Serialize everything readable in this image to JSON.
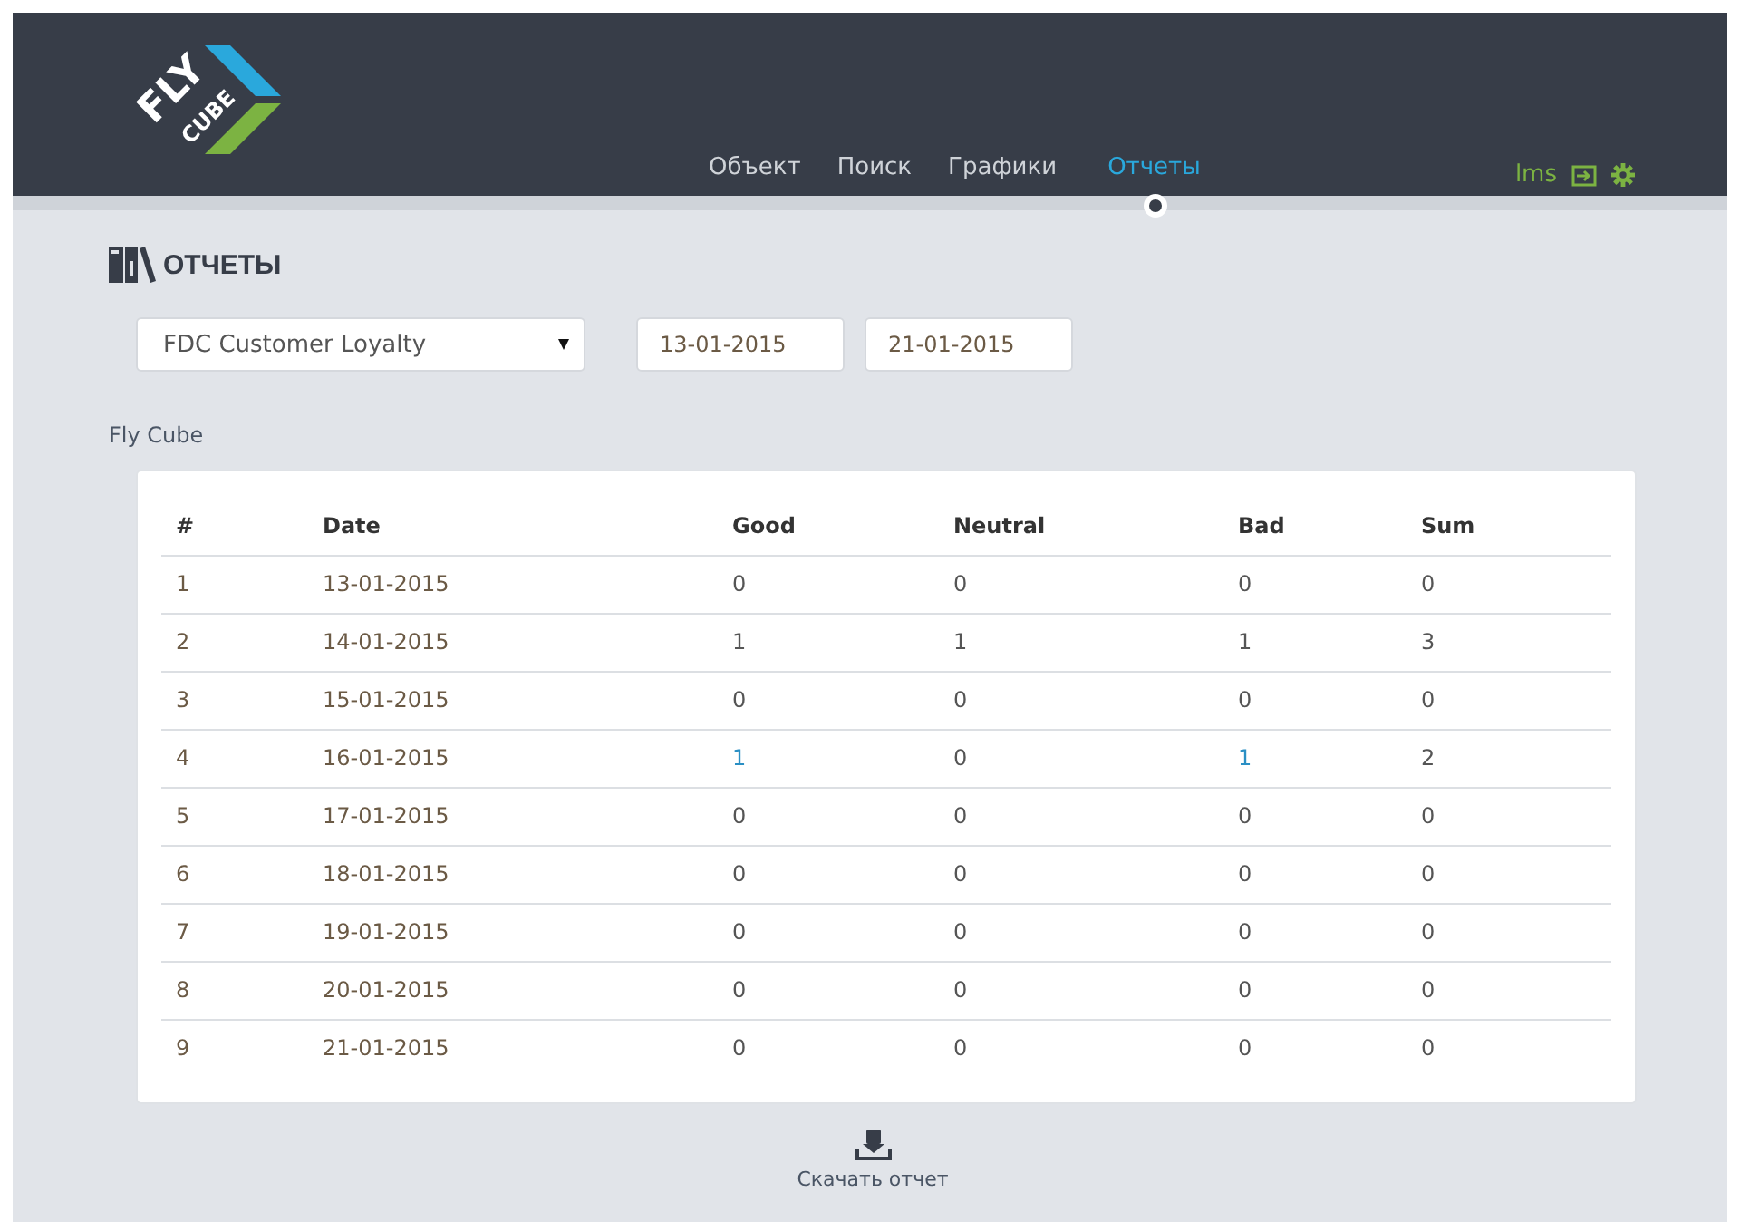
{
  "header": {
    "logo": {
      "line_1": "FLY",
      "line_2": "CUBE"
    },
    "nav": [
      {
        "label": "Объект",
        "selected": false
      },
      {
        "label": "Поиск",
        "selected": false
      },
      {
        "label": "Графики",
        "selected": false
      },
      {
        "label": "Отчеты",
        "selected": true
      }
    ],
    "user": "lms"
  },
  "page_title": "ОТЧЕТЫ",
  "filters": {
    "report": "FDC Customer Loyalty",
    "date_from": "13-01-2015",
    "date_to": "21-01-2015"
  },
  "section_label": "Fly Cube",
  "table": {
    "columns": [
      "#",
      "Date",
      "Good",
      "Neutral",
      "Bad",
      "Sum"
    ],
    "rows": [
      [
        {
          "text": "1",
          "kind": "plain"
        },
        {
          "text": "13-01-2015",
          "kind": "plain"
        },
        {
          "text": "0",
          "kind": "plain"
        },
        {
          "text": "0",
          "kind": "plain"
        },
        {
          "text": "0",
          "kind": "plain"
        },
        {
          "text": "0",
          "kind": "plain"
        }
      ],
      [
        {
          "text": "2",
          "kind": "plain"
        },
        {
          "text": "14-01-2015",
          "kind": "plain"
        },
        {
          "text": "1",
          "kind": "plain"
        },
        {
          "text": "1",
          "kind": "plain"
        },
        {
          "text": "1",
          "kind": "plain"
        },
        {
          "text": "3",
          "kind": "plain"
        }
      ],
      [
        {
          "text": "3",
          "kind": "plain"
        },
        {
          "text": "15-01-2015",
          "kind": "plain"
        },
        {
          "text": "0",
          "kind": "plain"
        },
        {
          "text": "0",
          "kind": "plain"
        },
        {
          "text": "0",
          "kind": "plain"
        },
        {
          "text": "0",
          "kind": "plain"
        }
      ],
      [
        {
          "text": "4",
          "kind": "plain"
        },
        {
          "text": "16-01-2015",
          "kind": "plain"
        },
        {
          "text": "1",
          "kind": "link"
        },
        {
          "text": "0",
          "kind": "plain"
        },
        {
          "text": "1",
          "kind": "link"
        },
        {
          "text": "2",
          "kind": "plain"
        }
      ],
      [
        {
          "text": "5",
          "kind": "plain"
        },
        {
          "text": "17-01-2015",
          "kind": "plain"
        },
        {
          "text": "0",
          "kind": "plain"
        },
        {
          "text": "0",
          "kind": "plain"
        },
        {
          "text": "0",
          "kind": "plain"
        },
        {
          "text": "0",
          "kind": "plain"
        }
      ],
      [
        {
          "text": "6",
          "kind": "plain"
        },
        {
          "text": "18-01-2015",
          "kind": "plain"
        },
        {
          "text": "0",
          "kind": "plain"
        },
        {
          "text": "0",
          "kind": "plain"
        },
        {
          "text": "0",
          "kind": "plain"
        },
        {
          "text": "0",
          "kind": "plain"
        }
      ],
      [
        {
          "text": "7",
          "kind": "plain"
        },
        {
          "text": "19-01-2015",
          "kind": "plain"
        },
        {
          "text": "0",
          "kind": "plain"
        },
        {
          "text": "0",
          "kind": "plain"
        },
        {
          "text": "0",
          "kind": "plain"
        },
        {
          "text": "0",
          "kind": "plain"
        }
      ],
      [
        {
          "text": "8",
          "kind": "plain"
        },
        {
          "text": "20-01-2015",
          "kind": "plain"
        },
        {
          "text": "0",
          "kind": "plain"
        },
        {
          "text": "0",
          "kind": "plain"
        },
        {
          "text": "0",
          "kind": "plain"
        },
        {
          "text": "0",
          "kind": "plain"
        }
      ],
      [
        {
          "text": "9",
          "kind": "plain"
        },
        {
          "text": "21-01-2015",
          "kind": "plain"
        },
        {
          "text": "0",
          "kind": "plain"
        },
        {
          "text": "0",
          "kind": "plain"
        },
        {
          "text": "0",
          "kind": "plain"
        },
        {
          "text": "0",
          "kind": "plain"
        }
      ]
    ]
  },
  "download": {
    "label": "Скачать отчет"
  }
}
